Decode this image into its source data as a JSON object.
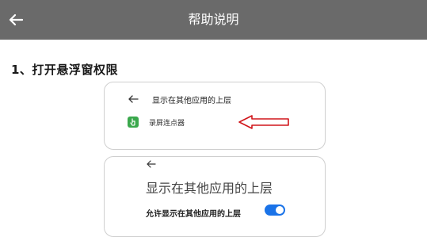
{
  "header": {
    "title": "帮助说明",
    "back_icon": "arrow-left-icon"
  },
  "section": {
    "heading": "1、打开悬浮窗权限"
  },
  "screenshot1": {
    "title": "显示在其他应用的上层",
    "app_name": "录屏连点器",
    "app_icon": "hand-tap-icon",
    "pointer_arrow_color": "#d0161b"
  },
  "screenshot2": {
    "title": "显示在其他应用的上层",
    "toggle_label": "允许显示在其他应用的上层",
    "toggle_on": true,
    "toggle_color": "#1a73e8"
  }
}
